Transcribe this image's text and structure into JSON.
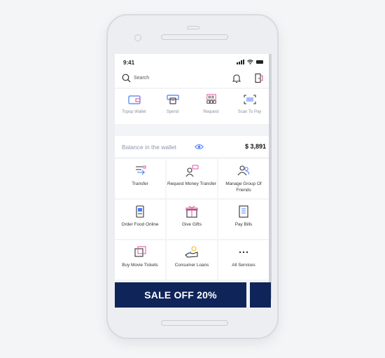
{
  "status_bar": {
    "time": "9:41"
  },
  "search": {
    "placeholder": "Search"
  },
  "quick_actions": [
    {
      "label": "Topup Wallet",
      "icon": "wallet-icon"
    },
    {
      "label": "Spend",
      "icon": "atm-icon"
    },
    {
      "label": "Request",
      "icon": "barcode-request-icon"
    },
    {
      "label": "Scan To Pay",
      "icon": "scan-barcode-icon"
    }
  ],
  "balance": {
    "label": "Balance in the wallet",
    "amount": "$ 3,891"
  },
  "services": [
    {
      "label": "Transfer",
      "icon": "transfer-icon"
    },
    {
      "label": "Request Money Transfer",
      "icon": "request-money-icon"
    },
    {
      "label": "Manage Group Of Friends",
      "icon": "group-icon"
    },
    {
      "label": "Order Food Online",
      "icon": "food-icon"
    },
    {
      "label": "Give Gifts",
      "icon": "gift-icon"
    },
    {
      "label": "Pay Bills",
      "icon": "bill-icon"
    },
    {
      "label": "Buy Movie Tickets",
      "icon": "ticket-icon"
    },
    {
      "label": "Consumer Loans",
      "icon": "loan-icon"
    },
    {
      "label": "All Services",
      "icon": "more-icon"
    }
  ],
  "banner": {
    "text": "SALE OFF 20%"
  },
  "colors": {
    "accent": "#4a7bf7",
    "banner": "#0f2459",
    "pink": "#e0529c"
  }
}
